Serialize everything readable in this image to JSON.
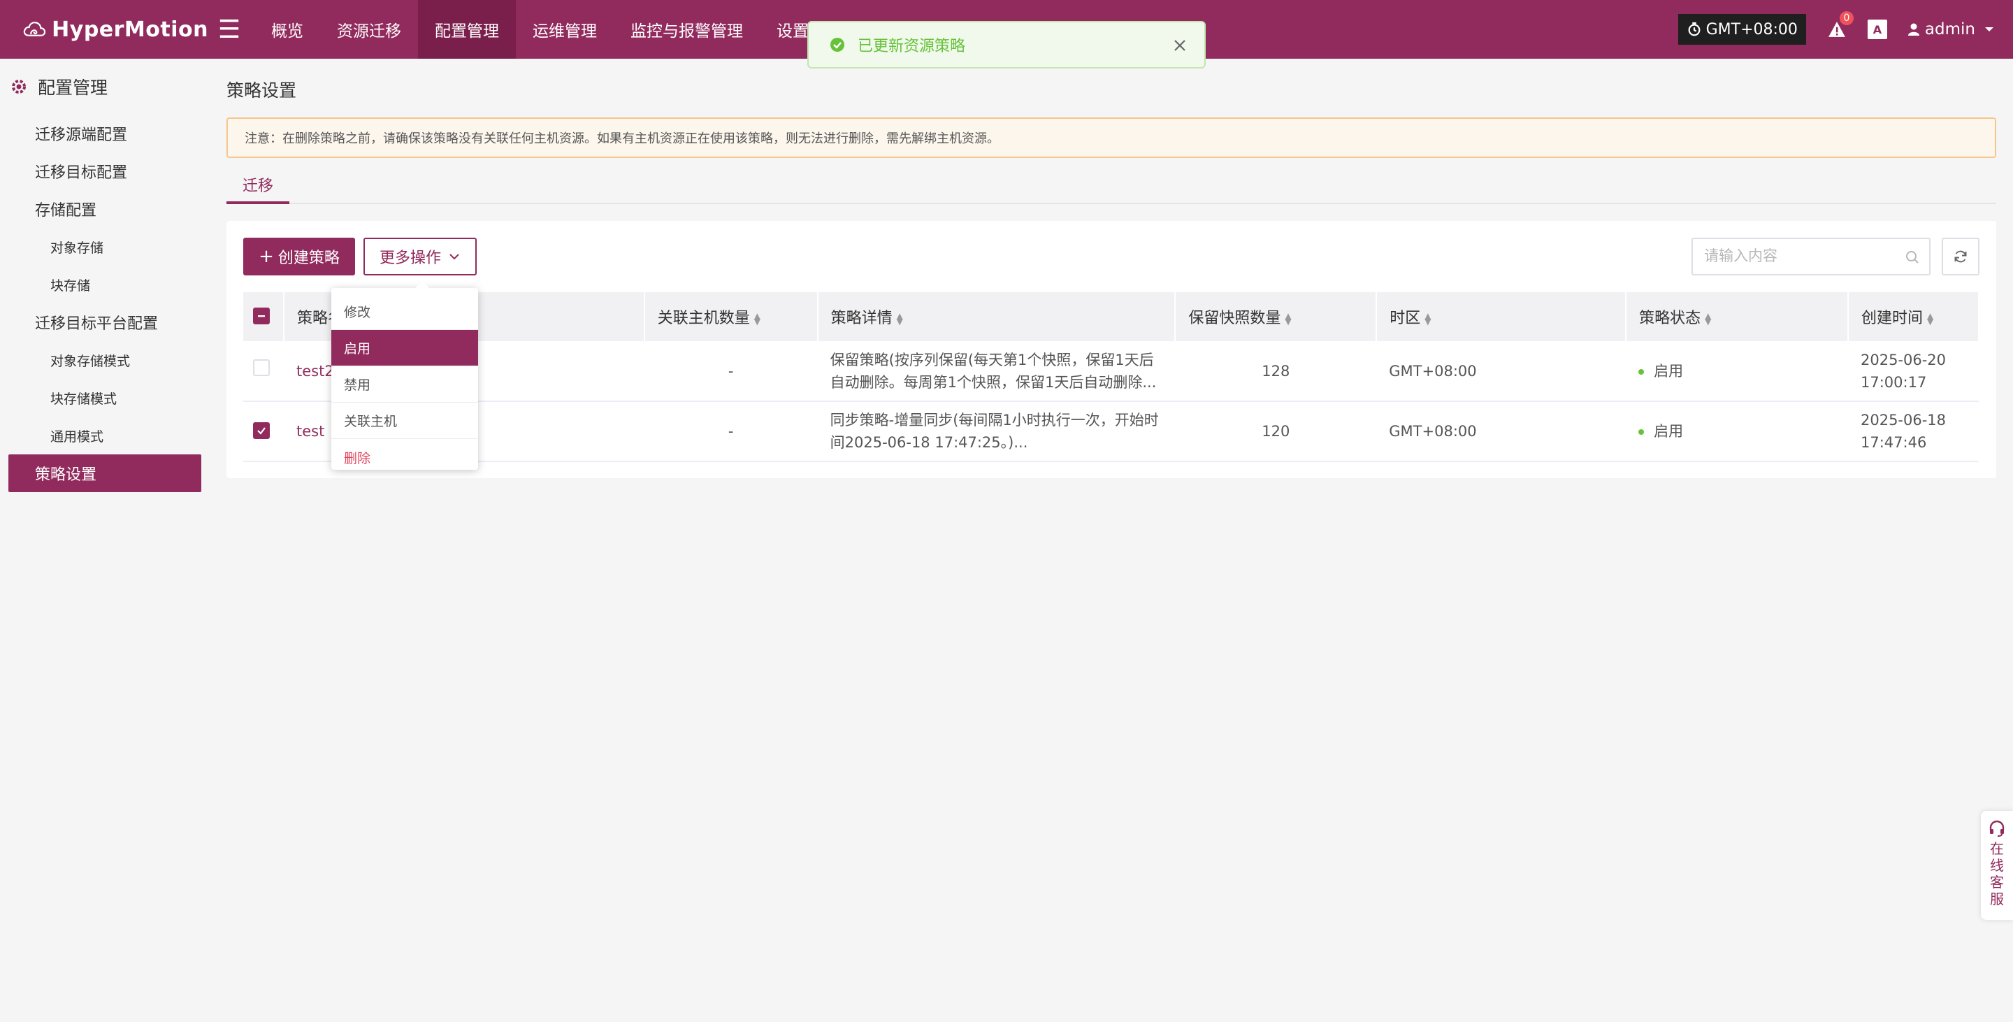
{
  "app": {
    "name": "HyperMotion"
  },
  "nav": [
    {
      "label": "概览",
      "active": false
    },
    {
      "label": "资源迁移",
      "active": false
    },
    {
      "label": "配置管理",
      "active": true
    },
    {
      "label": "运维管理",
      "active": false
    },
    {
      "label": "监控与报警管理",
      "active": false
    },
    {
      "label": "设置",
      "active": false
    }
  ],
  "header": {
    "timezone": "GMT+08:00",
    "alert_count": "0",
    "lang_label": "A",
    "user": "admin"
  },
  "toast": {
    "message": "已更新资源策略"
  },
  "sidebar": {
    "title": "配置管理",
    "items": [
      {
        "label": "迁移源端配置",
        "level": 1
      },
      {
        "label": "迁移目标配置",
        "level": 1
      },
      {
        "label": "存储配置",
        "level": 1
      },
      {
        "label": "对象存储",
        "level": 2
      },
      {
        "label": "块存储",
        "level": 2
      },
      {
        "label": "迁移目标平台配置",
        "level": 1
      },
      {
        "label": "对象存储模式",
        "level": 2
      },
      {
        "label": "块存储模式",
        "level": 2
      },
      {
        "label": "通用模式",
        "level": 2
      },
      {
        "label": "策略设置",
        "level": 1,
        "active": true
      }
    ]
  },
  "page": {
    "title": "策略设置",
    "notice": "注意：在删除策略之前，请确保该策略没有关联任何主机资源。如果有主机资源正在使用该策略，则无法进行删除，需先解绑主机资源。",
    "tab": "迁移"
  },
  "toolbar": {
    "create_label": "创建策略",
    "more_label": "更多操作",
    "search_placeholder": "请输入内容"
  },
  "dropdown": {
    "items": [
      {
        "label": "修改",
        "state": "normal"
      },
      {
        "label": "启用",
        "state": "active"
      },
      {
        "label": "禁用",
        "state": "normal"
      },
      {
        "label": "关联主机",
        "state": "normal"
      },
      {
        "label": "删除",
        "state": "danger"
      }
    ]
  },
  "table": {
    "columns": [
      "策略名称",
      "关联主机数量",
      "策略详情",
      "保留快照数量",
      "时区",
      "策略状态",
      "创建时间"
    ],
    "header_partial_name": "策略名",
    "rows": [
      {
        "checked": false,
        "name": "test2",
        "hosts": "-",
        "detail_line1": "保留策略(按序列保留(每天第1个快照，保留1天后",
        "detail_line2": "自动删除。每周第1个快照，保留1天后自动删除...",
        "snapshots": "128",
        "timezone": "GMT+08:00",
        "status": "启用",
        "date": "2025-06-20",
        "time": "17:00:17"
      },
      {
        "checked": true,
        "name": "test",
        "hosts": "-",
        "detail_line1": "同步策略-增量同步(每间隔1小时执行一次，开始时",
        "detail_line2": "间2025-06-18 17:47:25。)...",
        "snapshots": "120",
        "timezone": "GMT+08:00",
        "status": "启用",
        "date": "2025-06-18",
        "time": "17:47:46"
      }
    ]
  },
  "online_service": {
    "label_chars": [
      "在",
      "线",
      "客",
      "服"
    ]
  },
  "colors": {
    "brand": "#922b5d",
    "success": "#67c23a",
    "danger": "#e0445a",
    "warning_border": "#f5c68d"
  }
}
